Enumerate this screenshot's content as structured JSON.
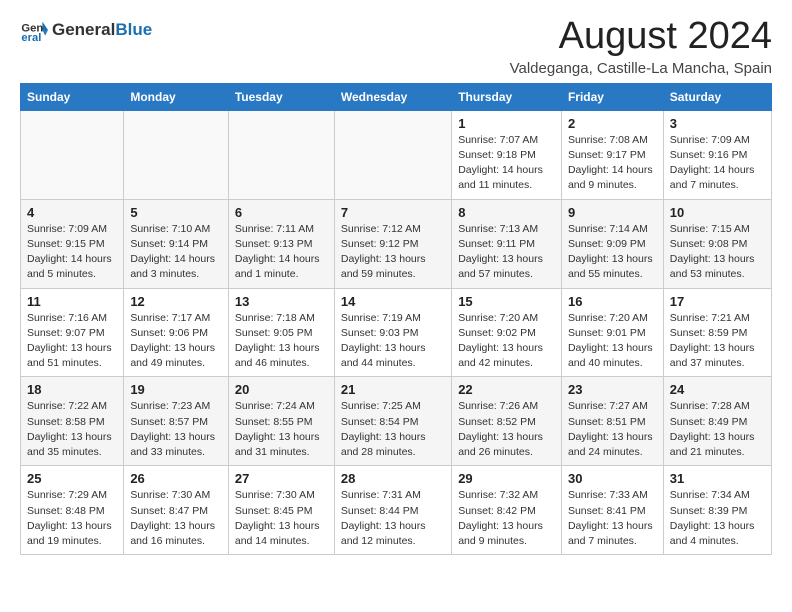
{
  "header": {
    "logo_general": "General",
    "logo_blue": "Blue",
    "title": "August 2024",
    "subtitle": "Valdeganga, Castille-La Mancha, Spain"
  },
  "calendar": {
    "weekdays": [
      "Sunday",
      "Monday",
      "Tuesday",
      "Wednesday",
      "Thursday",
      "Friday",
      "Saturday"
    ],
    "weeks": [
      [
        {
          "day": "",
          "info": ""
        },
        {
          "day": "",
          "info": ""
        },
        {
          "day": "",
          "info": ""
        },
        {
          "day": "",
          "info": ""
        },
        {
          "day": "1",
          "info": "Sunrise: 7:07 AM\nSunset: 9:18 PM\nDaylight: 14 hours and 11 minutes."
        },
        {
          "day": "2",
          "info": "Sunrise: 7:08 AM\nSunset: 9:17 PM\nDaylight: 14 hours and 9 minutes."
        },
        {
          "day": "3",
          "info": "Sunrise: 7:09 AM\nSunset: 9:16 PM\nDaylight: 14 hours and 7 minutes."
        }
      ],
      [
        {
          "day": "4",
          "info": "Sunrise: 7:09 AM\nSunset: 9:15 PM\nDaylight: 14 hours and 5 minutes."
        },
        {
          "day": "5",
          "info": "Sunrise: 7:10 AM\nSunset: 9:14 PM\nDaylight: 14 hours and 3 minutes."
        },
        {
          "day": "6",
          "info": "Sunrise: 7:11 AM\nSunset: 9:13 PM\nDaylight: 14 hours and 1 minute."
        },
        {
          "day": "7",
          "info": "Sunrise: 7:12 AM\nSunset: 9:12 PM\nDaylight: 13 hours and 59 minutes."
        },
        {
          "day": "8",
          "info": "Sunrise: 7:13 AM\nSunset: 9:11 PM\nDaylight: 13 hours and 57 minutes."
        },
        {
          "day": "9",
          "info": "Sunrise: 7:14 AM\nSunset: 9:09 PM\nDaylight: 13 hours and 55 minutes."
        },
        {
          "day": "10",
          "info": "Sunrise: 7:15 AM\nSunset: 9:08 PM\nDaylight: 13 hours and 53 minutes."
        }
      ],
      [
        {
          "day": "11",
          "info": "Sunrise: 7:16 AM\nSunset: 9:07 PM\nDaylight: 13 hours and 51 minutes."
        },
        {
          "day": "12",
          "info": "Sunrise: 7:17 AM\nSunset: 9:06 PM\nDaylight: 13 hours and 49 minutes."
        },
        {
          "day": "13",
          "info": "Sunrise: 7:18 AM\nSunset: 9:05 PM\nDaylight: 13 hours and 46 minutes."
        },
        {
          "day": "14",
          "info": "Sunrise: 7:19 AM\nSunset: 9:03 PM\nDaylight: 13 hours and 44 minutes."
        },
        {
          "day": "15",
          "info": "Sunrise: 7:20 AM\nSunset: 9:02 PM\nDaylight: 13 hours and 42 minutes."
        },
        {
          "day": "16",
          "info": "Sunrise: 7:20 AM\nSunset: 9:01 PM\nDaylight: 13 hours and 40 minutes."
        },
        {
          "day": "17",
          "info": "Sunrise: 7:21 AM\nSunset: 8:59 PM\nDaylight: 13 hours and 37 minutes."
        }
      ],
      [
        {
          "day": "18",
          "info": "Sunrise: 7:22 AM\nSunset: 8:58 PM\nDaylight: 13 hours and 35 minutes."
        },
        {
          "day": "19",
          "info": "Sunrise: 7:23 AM\nSunset: 8:57 PM\nDaylight: 13 hours and 33 minutes."
        },
        {
          "day": "20",
          "info": "Sunrise: 7:24 AM\nSunset: 8:55 PM\nDaylight: 13 hours and 31 minutes."
        },
        {
          "day": "21",
          "info": "Sunrise: 7:25 AM\nSunset: 8:54 PM\nDaylight: 13 hours and 28 minutes."
        },
        {
          "day": "22",
          "info": "Sunrise: 7:26 AM\nSunset: 8:52 PM\nDaylight: 13 hours and 26 minutes."
        },
        {
          "day": "23",
          "info": "Sunrise: 7:27 AM\nSunset: 8:51 PM\nDaylight: 13 hours and 24 minutes."
        },
        {
          "day": "24",
          "info": "Sunrise: 7:28 AM\nSunset: 8:49 PM\nDaylight: 13 hours and 21 minutes."
        }
      ],
      [
        {
          "day": "25",
          "info": "Sunrise: 7:29 AM\nSunset: 8:48 PM\nDaylight: 13 hours and 19 minutes."
        },
        {
          "day": "26",
          "info": "Sunrise: 7:30 AM\nSunset: 8:47 PM\nDaylight: 13 hours and 16 minutes."
        },
        {
          "day": "27",
          "info": "Sunrise: 7:30 AM\nSunset: 8:45 PM\nDaylight: 13 hours and 14 minutes."
        },
        {
          "day": "28",
          "info": "Sunrise: 7:31 AM\nSunset: 8:44 PM\nDaylight: 13 hours and 12 minutes."
        },
        {
          "day": "29",
          "info": "Sunrise: 7:32 AM\nSunset: 8:42 PM\nDaylight: 13 hours and 9 minutes."
        },
        {
          "day": "30",
          "info": "Sunrise: 7:33 AM\nSunset: 8:41 PM\nDaylight: 13 hours and 7 minutes."
        },
        {
          "day": "31",
          "info": "Sunrise: 7:34 AM\nSunset: 8:39 PM\nDaylight: 13 hours and 4 minutes."
        }
      ]
    ]
  }
}
